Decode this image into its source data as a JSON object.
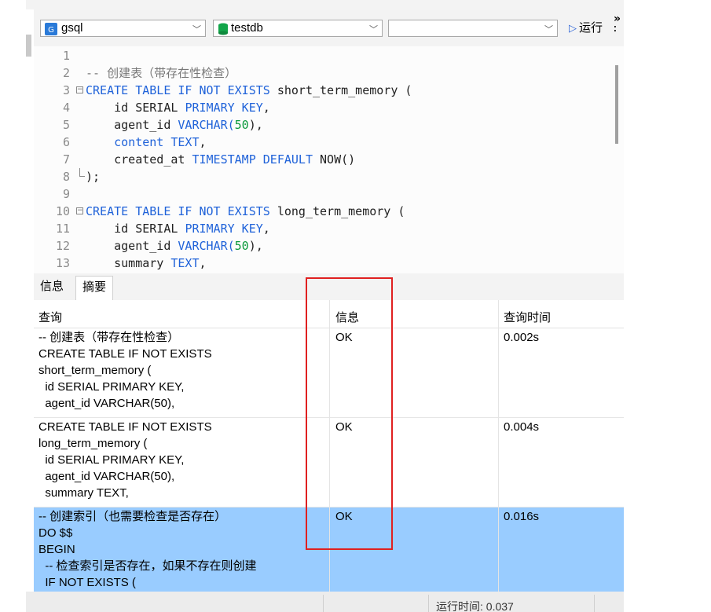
{
  "toolbar": {
    "connection_label": "gsql",
    "database_label": "testdb",
    "schema_label": "",
    "run_label": "运行",
    "more_label": "»"
  },
  "editor": {
    "lines": [
      {
        "n": "1",
        "code": [
          {
            "t": "",
            "c": ""
          }
        ]
      },
      {
        "n": "2",
        "code": [
          {
            "t": "-- 创建表（带存在性检查）",
            "c": "cmt"
          }
        ]
      },
      {
        "n": "3",
        "fold": "open",
        "code": [
          {
            "t": "CREATE TABLE IF NOT EXISTS ",
            "c": "kw"
          },
          {
            "t": "short_term_memory (",
            "c": ""
          }
        ]
      },
      {
        "n": "4",
        "code": [
          {
            "t": "    id SERIAL ",
            "c": ""
          },
          {
            "t": "PRIMARY KEY",
            "c": "kw"
          },
          {
            "t": ",",
            "c": ""
          }
        ]
      },
      {
        "n": "5",
        "code": [
          {
            "t": "    agent_id ",
            "c": ""
          },
          {
            "t": "VARCHAR(",
            "c": "kw"
          },
          {
            "t": "50",
            "c": "num"
          },
          {
            "t": "),",
            "c": ""
          }
        ]
      },
      {
        "n": "6",
        "code": [
          {
            "t": "    ",
            "c": ""
          },
          {
            "t": "content TEXT",
            "c": "kw"
          },
          {
            "t": ",",
            "c": ""
          }
        ]
      },
      {
        "n": "7",
        "code": [
          {
            "t": "    created_at ",
            "c": ""
          },
          {
            "t": "TIMESTAMP DEFAULT ",
            "c": "kw"
          },
          {
            "t": "NOW()",
            "c": ""
          }
        ]
      },
      {
        "n": "8",
        "fold": "end",
        "code": [
          {
            "t": ");",
            "c": ""
          }
        ]
      },
      {
        "n": "9",
        "code": [
          {
            "t": "",
            "c": ""
          }
        ]
      },
      {
        "n": "10",
        "fold": "open",
        "code": [
          {
            "t": "CREATE TABLE IF NOT EXISTS ",
            "c": "kw"
          },
          {
            "t": "long_term_memory (",
            "c": ""
          }
        ]
      },
      {
        "n": "11",
        "code": [
          {
            "t": "    id SERIAL ",
            "c": ""
          },
          {
            "t": "PRIMARY KEY",
            "c": "kw"
          },
          {
            "t": ",",
            "c": ""
          }
        ]
      },
      {
        "n": "12",
        "code": [
          {
            "t": "    agent_id ",
            "c": ""
          },
          {
            "t": "VARCHAR(",
            "c": "kw"
          },
          {
            "t": "50",
            "c": "num"
          },
          {
            "t": "),",
            "c": ""
          }
        ]
      },
      {
        "n": "13",
        "code": [
          {
            "t": "    summary ",
            "c": ""
          },
          {
            "t": "TEXT",
            "c": "kw"
          },
          {
            "t": ",",
            "c": ""
          }
        ]
      }
    ]
  },
  "tabs": [
    {
      "label": "信息",
      "active": false
    },
    {
      "label": "摘要",
      "active": true
    }
  ],
  "results": {
    "headers": [
      "查询",
      "信息",
      "查询时间"
    ],
    "rows": [
      {
        "query": [
          "-- 创建表（带存在性检查）",
          "CREATE TABLE IF NOT EXISTS",
          "short_term_memory (",
          "  id SERIAL PRIMARY KEY,",
          "  agent_id VARCHAR(50),"
        ],
        "info": "OK",
        "time": "0.002s",
        "selected": false
      },
      {
        "query": [
          "CREATE TABLE IF NOT EXISTS",
          "long_term_memory (",
          "  id SERIAL PRIMARY KEY,",
          "  agent_id VARCHAR(50),",
          "  summary TEXT,"
        ],
        "info": "OK",
        "time": "0.004s",
        "selected": false
      },
      {
        "query": [
          "-- 创建索引（也需要检查是否存在）",
          "DO $$",
          "BEGIN",
          "  -- 检查索引是否存在，如果不存在则创建",
          "  IF NOT EXISTS ("
        ],
        "info": "OK",
        "time": "0.016s",
        "selected": true
      }
    ]
  },
  "status": {
    "run_time": "运行时间: 0.037"
  },
  "colors": {
    "keyword": "#1f62d9",
    "number": "#0a9a3c",
    "selected_row": "#99ccff",
    "highlight_box": "#e02020"
  }
}
